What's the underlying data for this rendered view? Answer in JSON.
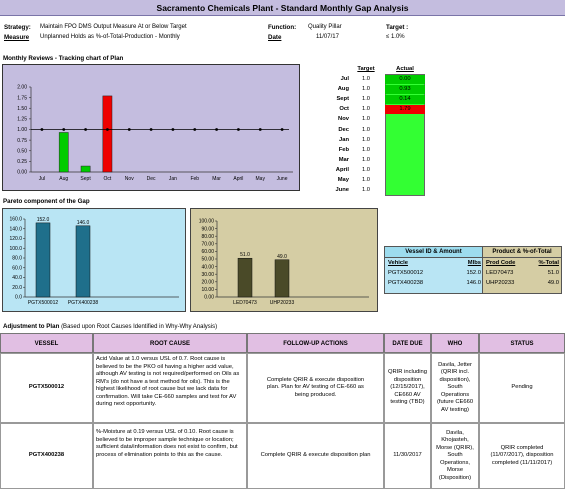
{
  "title": "Sacramento Chemicals Plant -  Standard Monthly Gap Analysis",
  "info": {
    "strategy_label": "Strategy:",
    "strategy_value": "Maintain FPO DMS Output Measure At or Below Target",
    "measure_label": "Measure",
    "measure_value": "Unplanned Holds as %-of-Total-Production - Monthly",
    "function_label": "Function:",
    "function_value": "Quality Pillar",
    "date_label": "Date",
    "date_value": "11/07/17",
    "target_label": "Target :",
    "target_value": "≤ 1.0%"
  },
  "monthly": {
    "section_title": "Monthly Reviews - Tracking chart of Plan",
    "col_target": "Target",
    "col_actual": "Actual",
    "months": [
      "Jul",
      "Aug",
      "Sept",
      "Oct",
      "Nov",
      "Dec",
      "Jan",
      "Feb",
      "Mar",
      "April",
      "May",
      "June"
    ],
    "targets": [
      "1.0",
      "1.0",
      "1.0",
      "1.0",
      "1.0",
      "1.0",
      "1.0",
      "1.0",
      "1.0",
      "1.0",
      "1.0",
      "1.0"
    ],
    "actuals": [
      "0.00",
      "0.93",
      "0.14",
      "1.79",
      "",
      "",
      "",
      "",
      "",
      "",
      "",
      ""
    ],
    "colors": {
      "good": "#00cc00",
      "bad": "#ee0000",
      "pending": "#33ff33"
    }
  },
  "chart_data": [
    {
      "type": "bar",
      "title": "",
      "categories": [
        "Jul",
        "Aug",
        "Sept",
        "Oct",
        "Nov",
        "Dec",
        "Jan",
        "Feb",
        "Mar",
        "April",
        "May",
        "June"
      ],
      "x_tick_labels": [
        "Jul",
        "Aug",
        "Sept",
        "Oct",
        "Nov",
        "Dec",
        "Jan",
        "Feb",
        "Mar",
        "April",
        "May",
        "June"
      ],
      "values": [
        0.0,
        0.93,
        0.14,
        1.79,
        null,
        null,
        null,
        null,
        null,
        null,
        null,
        null
      ],
      "bar_colors": [
        "#00cc00",
        "#00cc00",
        "#00cc00",
        "#ee0000"
      ],
      "target_line": 1.0,
      "ylim": [
        0,
        2.0
      ],
      "yticks": [
        "0.00",
        "0.25",
        "0.50",
        "0.75",
        "1.00",
        "1.25",
        "1.50",
        "1.75",
        "2.00"
      ],
      "background": "#c4bddf",
      "grid": false
    },
    {
      "type": "bar",
      "title": "",
      "categories": [
        "PGTX500012",
        "PGTX400238"
      ],
      "values": [
        152.0,
        146.0
      ],
      "data_labels": [
        "152.0",
        "146.0"
      ],
      "ylim": [
        0,
        160
      ],
      "yticks": [
        "0.0",
        "20.0",
        "40.0",
        "60.0",
        "80.0",
        "100.0",
        "120.0",
        "140.0",
        "160.0"
      ],
      "bar_color": "#1f6f8b",
      "background": "#b9e5f4"
    },
    {
      "type": "bar",
      "title": "",
      "categories": [
        "LED70473",
        "UHP20233"
      ],
      "values": [
        51.0,
        49.0
      ],
      "data_labels": [
        "51.0",
        "49.0"
      ],
      "ylim": [
        0,
        100
      ],
      "yticks": [
        "0.00",
        "10.00",
        "20.00",
        "30.00",
        "40.00",
        "50.00",
        "60.00",
        "70.00",
        "80.00",
        "90.00",
        "100.00"
      ],
      "bar_color": "#4a4a28",
      "background": "#d5cda4"
    }
  ],
  "pareto": {
    "section_title": "Pareto component of the Gap"
  },
  "vessel_table": {
    "header_left": "Vessel ID & Amount",
    "header_right": "Product & %-of-Total",
    "col_vehicle": "Vehicle",
    "col_mlbs": "Mlbs",
    "col_prod_code": "Prod Code",
    "col_pct": "%-Total",
    "rows": [
      {
        "vehicle": "PGTX500012",
        "mlbs": "152.0",
        "prod_code": "LED70473",
        "pct": "51.0"
      },
      {
        "vehicle": "PGTX400238",
        "mlbs": "146.0",
        "prod_code": "UHP20233",
        "pct": "49.0"
      }
    ],
    "colors": {
      "left_header": "#9ddcee",
      "right_header": "#d5cda4"
    }
  },
  "adjustment": {
    "section_title": "Adjustment to Plan",
    "section_subtitle": "(Based upon Root Causes Identified in Why-Why Analysis)",
    "headers": [
      "VESSEL",
      "ROOT CAUSE",
      "FOLLOW-UP ACTIONS",
      "DATE DUE",
      "WHO",
      "STATUS"
    ],
    "rows": [
      {
        "vessel": "PGTX500012",
        "root_cause": "Acid Value at 1.0 versus USL of 0.7.  Root cause is believed to be the PKO oil having a higher acid value, although AV testing is not required/performed on Oils as RM's (do not have a test method for oils).  This is the highest likelihood of root cause but we lack data for confirmation.  Will take CE-660 samples and test for AV during next opportunity.",
        "actions": "Complete QRIR & execute disposition plan. Plan for AV testing of CE-660 as being produced.",
        "date_due": "QRIR including disposition (12/15/2017), CE660 AV testing (TBD)",
        "who": "Davila, Jetter (QRIR incl. disposition), South Operations (future CE660 AV testing)",
        "status": "Pending"
      },
      {
        "vessel": "PGTX400238",
        "root_cause": "%-Moisture at 0.19 versus USL of 0.10.  Root cause is believed to be improper sample technique or location; sufficient data/information does not exist to confirm, but process of elimination points to this as the cause.",
        "actions": "Complete QRIR & execute disposition plan",
        "date_due": "11/30/2017",
        "who": "Davila, Khojasteh, Morse (QRIR), South Operations, Morse (Disposition)",
        "status": "QRIR completed (11/07/2017), disposition completed (11/11/2017)"
      }
    ]
  }
}
